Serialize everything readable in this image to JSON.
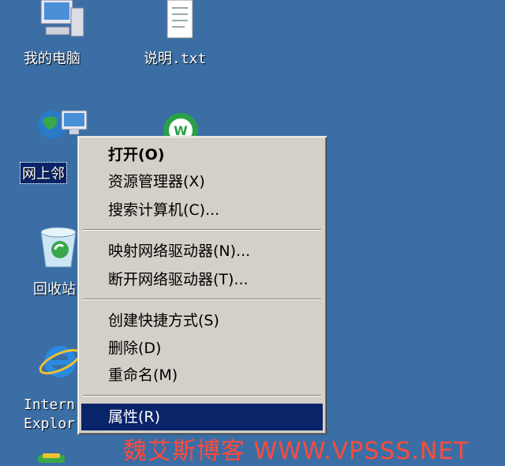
{
  "desktop": {
    "icons": [
      {
        "name": "my-computer",
        "label": "我的电脑"
      },
      {
        "name": "readme-file",
        "label": "说明.txt"
      },
      {
        "name": "network-places",
        "label": "网上邻"
      },
      {
        "name": "recycle-bin",
        "label": "回收站"
      },
      {
        "name": "internet-explorer",
        "label_line1": "Intern",
        "label_line2": "Explor"
      }
    ]
  },
  "context_menu": {
    "items": [
      {
        "label": "打开(O)",
        "bold": true
      },
      {
        "label": "资源管理器(X)"
      },
      {
        "label": "搜索计算机(C)..."
      },
      {
        "label": "映射网络驱动器(N)..."
      },
      {
        "label": "断开网络驱动器(T)..."
      },
      {
        "label": "创建快捷方式(S)"
      },
      {
        "label": "删除(D)"
      },
      {
        "label": "重命名(M)"
      },
      {
        "label": "属性(R)",
        "highlighted": true
      }
    ]
  },
  "watermark": "魏艾斯博客 WWW.VPSSS.NET",
  "colors": {
    "desktop_bg": "#3a6ea5",
    "menu_bg": "#d4d0c8",
    "highlight": "#0a246a",
    "watermark": "#ff4b3a"
  }
}
